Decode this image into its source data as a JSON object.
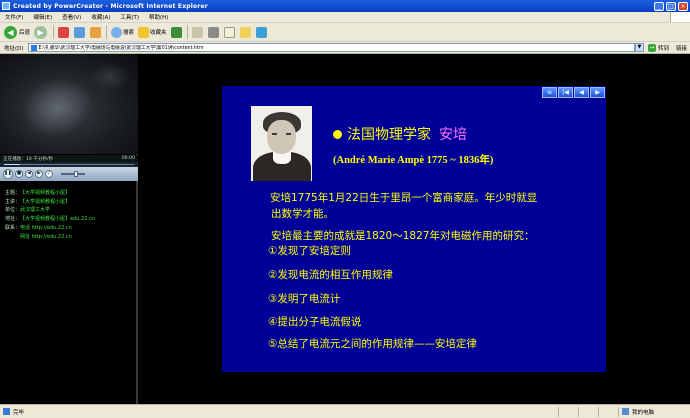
{
  "window": {
    "title": "Created by PowerCreator - Microsoft Internet Explorer",
    "buttons": [
      "_",
      "□",
      "×"
    ]
  },
  "menu": [
    "文件(F)",
    "编辑(E)",
    "查看(V)",
    "收藏(A)",
    "工具(T)",
    "帮助(H)"
  ],
  "toolbar": {
    "back_label": "后退",
    "search_label": "搜索",
    "favorites_label": "收藏夹"
  },
  "address": {
    "label": "地址(D)",
    "url": "E:\\孔睿华\\武汉理工大学\\电磁场与电磁波\\武汉理工大学\\第01讲\\content.htm",
    "go_label": "转到",
    "links_label": "链接"
  },
  "player": {
    "status_left": "正在播放：19 千分秒/秒",
    "status_right": "00:00",
    "progress": 0.12,
    "volume": 0.65
  },
  "course_info": [
    {
      "key": "主题：",
      "value": "【大学视频教程小屋】"
    },
    {
      "key": "主讲：",
      "value": "【大学视频教程小屋】"
    },
    {
      "key": "单位：",
      "value": "武汉理工大学"
    },
    {
      "key": "地址：",
      "value": "【大学视频教程小屋】edu.22.cn"
    },
    {
      "key": "联系：",
      "value": "电话  http://edu.22.cn"
    },
    {
      "key": "",
      "value": "网址  http://edu.22.cn"
    }
  ],
  "slide": {
    "nav_buttons": [
      "≡",
      "|◀",
      "◀",
      "▶"
    ],
    "heading": "法国物理学家",
    "heading_name": "安培",
    "subheading": "(André Marie Ampè 1775 ~ 1836年)",
    "para1_line1": "安培1775年1月22日生于里昂一个富商家庭。年少时就显",
    "para1_line2": "出数学才能。",
    "para2": "安培最主要的成就是1820～1827年对电磁作用的研究：",
    "items": [
      "①发现了安培定则",
      "②发现电流的相互作用规律",
      "③发明了电流计",
      "④提出分子电流假说",
      "⑤总结了电流元之间的作用规律——安培定律"
    ]
  },
  "status": {
    "done": "完毕",
    "zone": "我的电脑"
  },
  "colors": {
    "slide_bg": "#000099",
    "slide_text": "#ffff00",
    "name_accent": "#ff77ff",
    "info_text": "#3de03d"
  }
}
